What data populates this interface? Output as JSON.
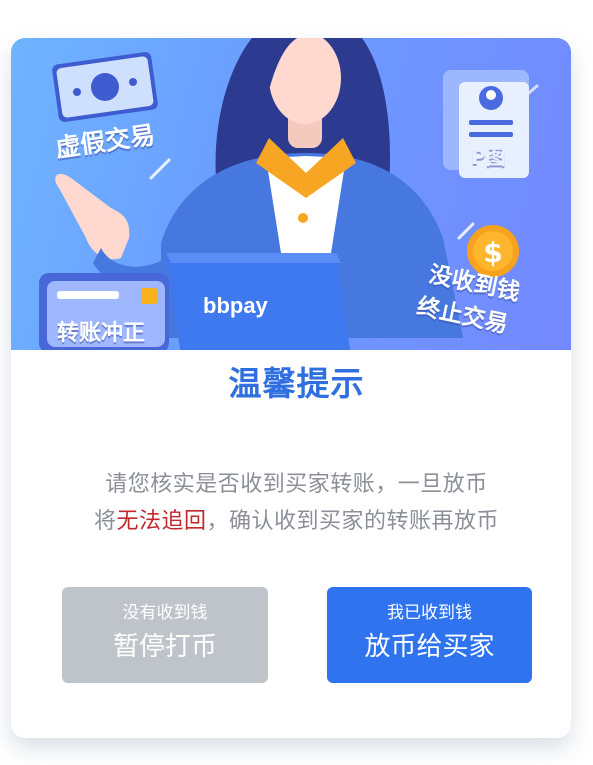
{
  "hero": {
    "tag_fake_trade": "虚假交易",
    "tag_p_image": "P图",
    "tag_transfer_reversal": "转账冲正",
    "tag_no_money_line1": "没收到钱",
    "tag_no_money_line2": "终止交易",
    "laptop_brand": "bbpay",
    "icons": [
      "money-bill-icon",
      "id-card-icon",
      "bank-card-icon",
      "dollar-coin-icon",
      "laptop-icon"
    ]
  },
  "dialog": {
    "title": "温馨提示",
    "message_line1": "请您核实是否收到买家转账，一旦放币",
    "message_line2_prefix": "将",
    "message_line2_warning": "无法追回",
    "message_line2_suffix": "，确认收到买家的转账再放币"
  },
  "buttons": {
    "pause_sub": "没有收到钱",
    "pause_main": "暂停打币",
    "release_sub": "我已收到钱",
    "release_main": "放币给买家"
  },
  "colors": {
    "title": "#2f6fe0",
    "warning": "#c0282d",
    "pause_button": "#bfc4cb",
    "release_button": "#2f73ef",
    "hero_start": "#6fb4ff",
    "hero_end": "#7488ff"
  }
}
